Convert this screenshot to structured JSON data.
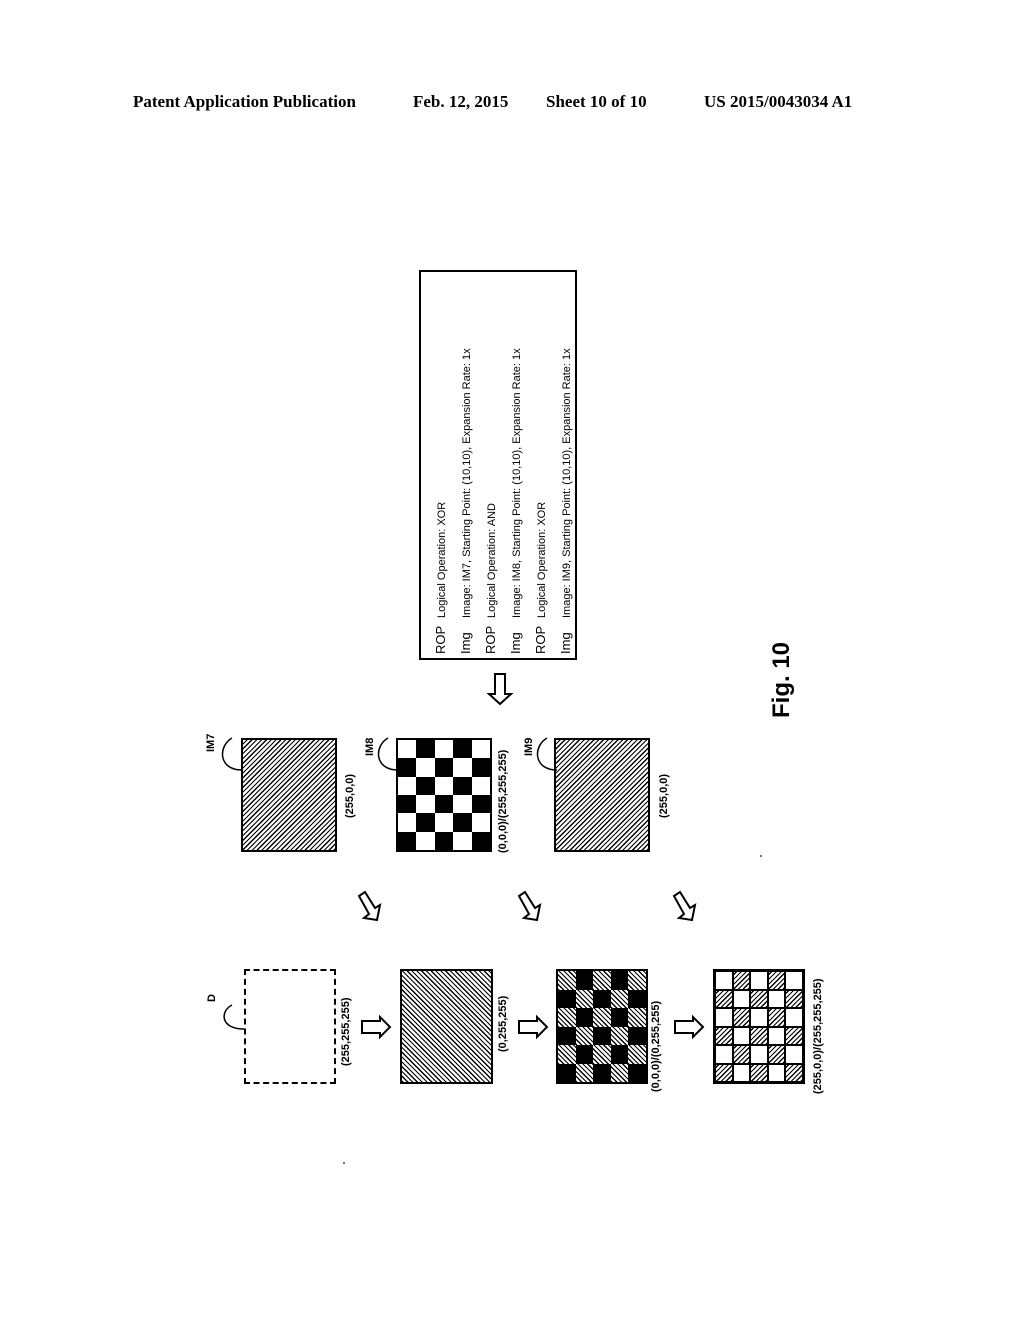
{
  "header": {
    "publication": "Patent Application Publication",
    "date": "Feb. 12, 2015",
    "sheet": "Sheet 10 of 10",
    "number": "US 2015/0043034 A1"
  },
  "legend": {
    "rows": [
      {
        "key": "ROP",
        "value": "Logical Operation: XOR"
      },
      {
        "key": "Img",
        "value": "Image: IM7, Starting Point: (10,10), Expansion Rate: 1x"
      },
      {
        "key": "ROP",
        "value": "Logical Operation: AND"
      },
      {
        "key": "Img",
        "value": "Image: IM8, Starting Point: (10,10), Expansion Rate: 1x"
      },
      {
        "key": "ROP",
        "value": "Logical Operation: XOR"
      },
      {
        "key": "Img",
        "value": "Image: IM9, Starting Point: (10,10), Expansion Rate: 1x"
      }
    ]
  },
  "source_images": [
    {
      "ref": "IM7",
      "color": "(255,0,0)",
      "pattern": "hatch"
    },
    {
      "ref": "IM8",
      "color": "(0,0,0)/(255,255,255)",
      "pattern": "checker-black-white"
    },
    {
      "ref": "IM9",
      "color": "(255,0,0)",
      "pattern": "hatch"
    }
  ],
  "destination_images": [
    {
      "ref": "D",
      "color": "(255,255,255)",
      "pattern": "blank-dashed"
    },
    {
      "color": "(0,255,255)",
      "pattern": "hatch"
    },
    {
      "color": "(0,0,0)/(0,255,255)",
      "pattern": "checker-black-hatch"
    },
    {
      "color": "(255,0,0)/(255,255,255)",
      "pattern": "checker-white-hatch"
    }
  ],
  "figure_label": "Fig. 10"
}
